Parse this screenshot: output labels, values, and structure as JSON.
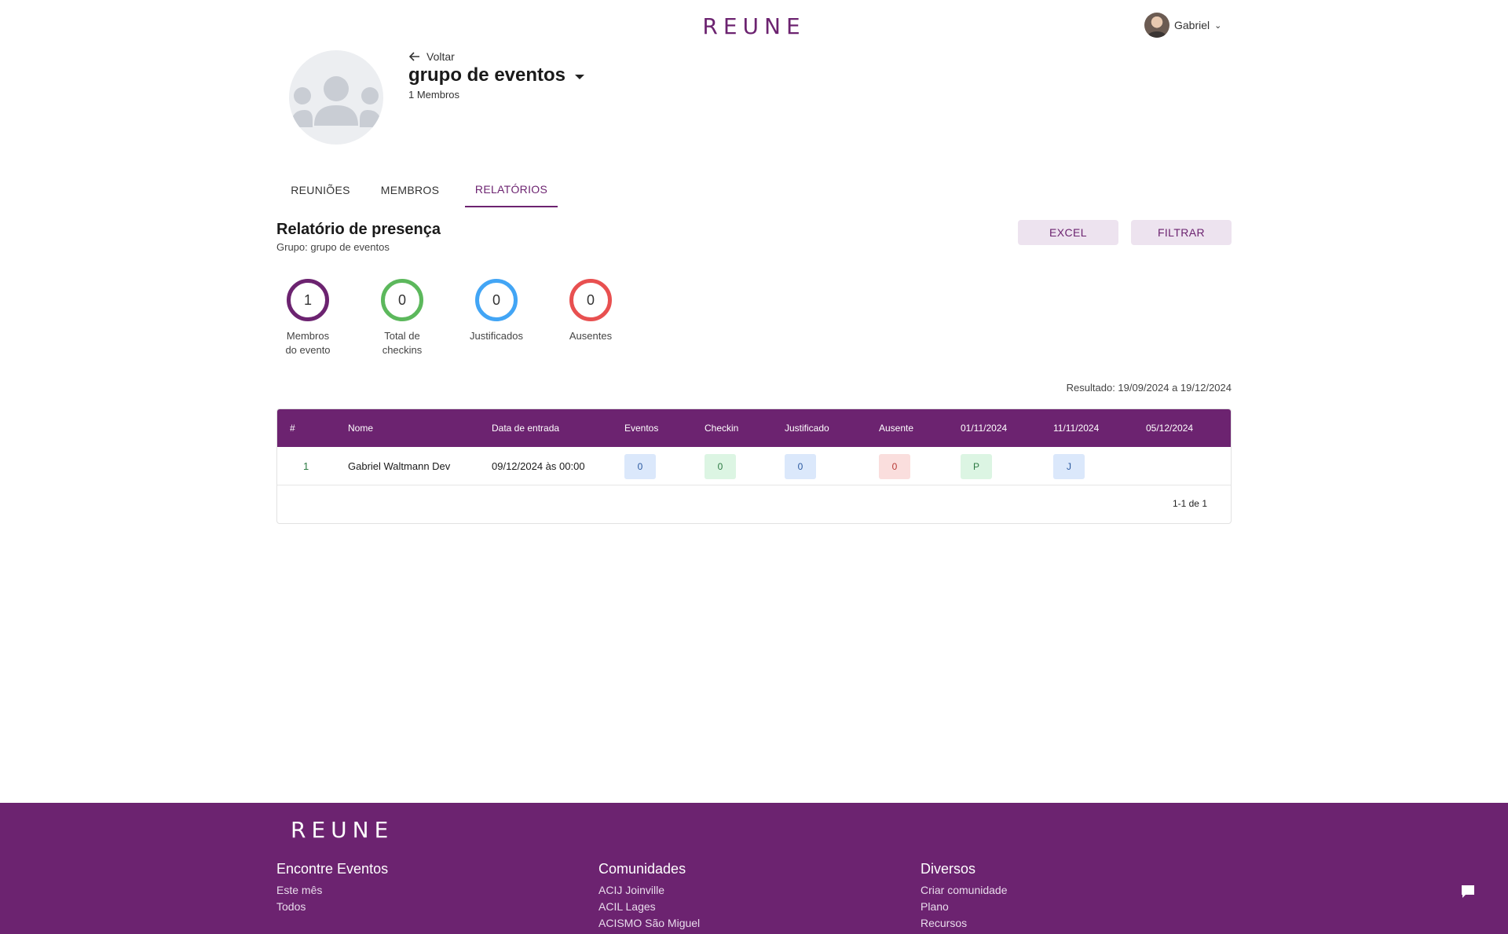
{
  "header": {
    "logo_text": "REUNE",
    "user_name": "Gabriel",
    "user_chevron": "⌄"
  },
  "group": {
    "back_label": "Voltar",
    "name": "grupo de eventos",
    "members_count": "1 Membros"
  },
  "tabs": [
    {
      "label": "REUNIÕES",
      "active": false
    },
    {
      "label": "MEMBROS",
      "active": false
    },
    {
      "label": "RELATÓRIOS",
      "active": true
    }
  ],
  "report": {
    "title": "Relatório de presença",
    "subtitle": "Grupo: grupo de eventos",
    "excel_label": "EXCEL",
    "filter_label": "FILTRAR",
    "result_range": "Resultado: 19/09/2024 a 19/12/2024"
  },
  "stats": [
    {
      "value": "1",
      "label_line1": "Membros",
      "label_line2": "do evento",
      "color": "#6c2370"
    },
    {
      "value": "0",
      "label_line1": "Total de",
      "label_line2": "checkins",
      "color": "#5cb85c"
    },
    {
      "value": "0",
      "label_line1": "Justificados",
      "label_line2": "",
      "color": "#42a5f5"
    },
    {
      "value": "0",
      "label_line1": "Ausentes",
      "label_line2": "",
      "color": "#e85050"
    }
  ],
  "table": {
    "columns": [
      "#",
      "Nome",
      "Data de entrada",
      "Eventos",
      "Checkin",
      "Justificado",
      "Ausente",
      "01/11/2024",
      "11/11/2024",
      "05/12/2024"
    ],
    "rows": [
      {
        "index": "1",
        "name": "Gabriel Waltmann Dev",
        "entry_date": "09/12/2024 às 00:00",
        "eventos": "0",
        "checkin": "0",
        "justificado": "0",
        "ausente": "0",
        "d_01_11": "P",
        "d_11_11": "J",
        "d_05_12": ""
      }
    ],
    "pagination": "1-1 de 1"
  },
  "footer": {
    "logo_text": "REUNE",
    "columns": [
      {
        "title": "Encontre Eventos",
        "links": [
          "Este mês",
          "Todos"
        ]
      },
      {
        "title": "Comunidades",
        "links": [
          "ACIJ Joinville",
          "ACIL Lages",
          "ACISMO São Miguel"
        ]
      },
      {
        "title": "Diversos",
        "links": [
          "Criar comunidade",
          "Plano",
          "Recursos"
        ]
      }
    ]
  },
  "colors": {
    "brand": "#6c2370",
    "brand_light": "#ede3ef",
    "checkin_green": "#5cb85c",
    "justified_blue": "#42a5f5",
    "absent_red": "#e85050"
  },
  "icons": {
    "back": "arrow-left-icon",
    "dropdown": "caret-down-icon",
    "user_menu": "chevron-down-icon",
    "chat": "chat-bubble-icon",
    "group_placeholder": "group-placeholder-icon"
  }
}
